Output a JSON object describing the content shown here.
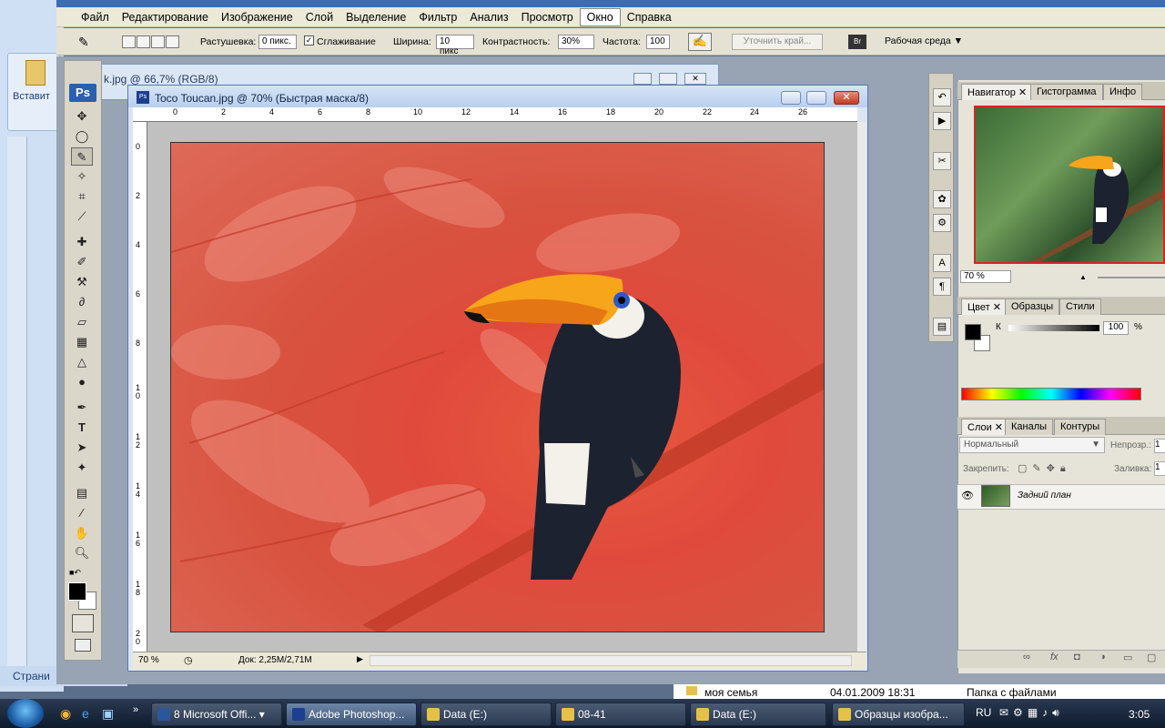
{
  "photoshop": {
    "menu": [
      "Файл",
      "Редактирование",
      "Изображение",
      "Слой",
      "Выделение",
      "Фильтр",
      "Анализ",
      "Просмотр",
      "Окно",
      "Справка"
    ],
    "options": {
      "feather_label": "Растушевка:",
      "feather_value": "0 пикс.",
      "antialias_label": "Сглаживание",
      "width_label": "Ширина:",
      "width_value": "10 пикс",
      "contrast_label": "Контрастность:",
      "contrast_value": "30%",
      "frequency_label": "Частота:",
      "frequency_value": "100",
      "refine_edge": "Уточнить край...",
      "workspace": "Рабочая среда"
    },
    "back_document_title": "k.jpg @ 66,7% (RGB/8)",
    "document": {
      "title": "Toco Toucan.jpg @ 70% (Быстрая маска/8)",
      "zoom": "70 %",
      "doc_info": "Док: 2,25М/2,71М",
      "h_ruler": [
        "0",
        "2",
        "4",
        "6",
        "8",
        "10",
        "12",
        "14",
        "16",
        "18",
        "20",
        "22",
        "24",
        "26"
      ],
      "v_ruler": [
        "0",
        "2",
        "4",
        "6",
        "8",
        "1\n0",
        "1\n2",
        "1\n4",
        "1\n6",
        "1\n8",
        "2\n0"
      ]
    },
    "toolbox_logo": "Ps",
    "panels": {
      "nav_tabs": [
        "Навигатор",
        "Гистограмма",
        "Инфо"
      ],
      "nav_zoom": "70 %",
      "color_tabs": [
        "Цвет",
        "Образцы",
        "Стили"
      ],
      "color_channel": "К",
      "color_value": "100",
      "color_unit": "%",
      "layer_tabs": [
        "Слои",
        "Каналы",
        "Контуры"
      ],
      "blend_mode": "Нормальный",
      "opacity_label": "Непрозр.:",
      "opacity_value": "1",
      "lock_label": "Закрепить:",
      "fill_label": "Заливка:",
      "fill_value": "1",
      "layer_name": "Задний план"
    }
  },
  "word": {
    "paste_label": "Вставит",
    "status": "Страни"
  },
  "explorer_strip": {
    "item": "моя семья",
    "date": "04.01.2009 18:31",
    "type": "Папка с файлами"
  },
  "taskbar": {
    "buttons": [
      {
        "label": "8 Microsoft Offi...",
        "color": "#2b579a"
      },
      {
        "label": "Adobe Photoshop...",
        "color": "#1d3f8f"
      },
      {
        "label": "Data (E:)",
        "color": "#e6c14a"
      },
      {
        "label": "08-41",
        "color": "#e6c14a"
      },
      {
        "label": "Data (E:)",
        "color": "#e6c14a"
      },
      {
        "label": "Образцы изобра...",
        "color": "#e6c14a"
      }
    ],
    "lang": "RU",
    "clock": "3:05"
  }
}
